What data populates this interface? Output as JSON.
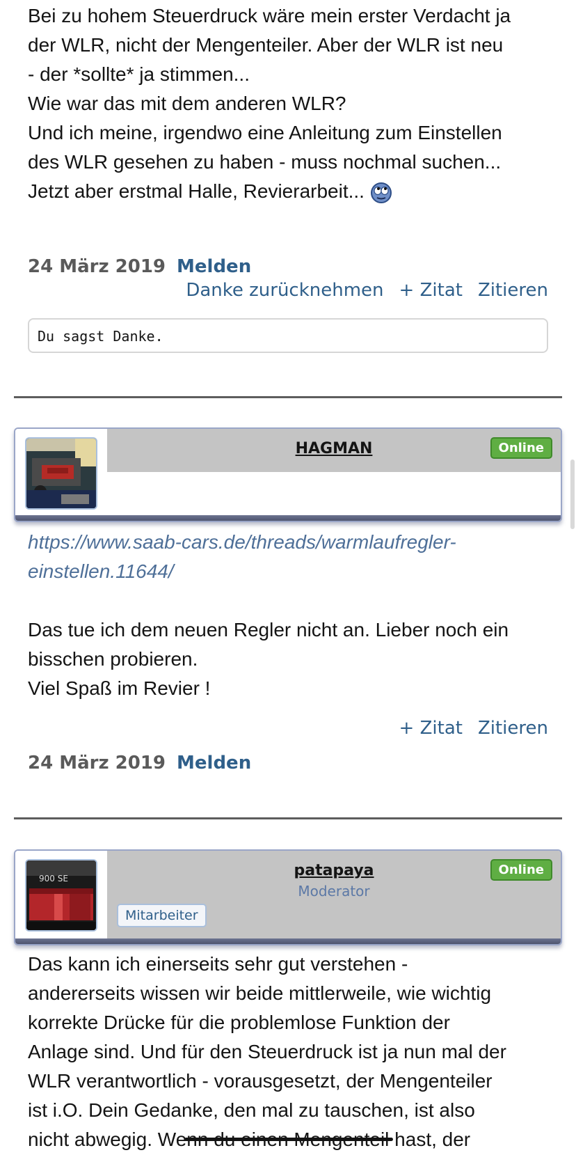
{
  "post1": {
    "lines": [
      "Bei zu hohem Steuerdruck wäre mein erster Verdacht ja",
      "der WLR, nicht der Mengenteiler. Aber der WLR ist neu",
      "- der *sollte* ja stimmen...",
      "Wie war das mit dem anderen WLR?",
      "Und ich meine, irgendwo eine Anleitung zum Einstellen",
      "des WLR gesehen zu haben - muss nochmal suchen...",
      "Jetzt aber erstmal Halle, Revierarbeit..."
    ],
    "date": "24 März 2019",
    "report": "Melden",
    "undo_thanks": "Danke zurücknehmen",
    "plus_quote": "+ Zitat",
    "quote": "Zitieren",
    "thanks_note": "Du sagst Danke."
  },
  "card1": {
    "username": "HAGMAN",
    "status": "Online",
    "avatar_icon": "engine-photo"
  },
  "post2": {
    "link_line1": "https://www.saab-cars.de/threads/warmlaufregler-",
    "link_line2": "einstellen.11644/",
    "lines": [
      "Das tue ich dem neuen Regler nicht an. Lieber noch ein",
      "bisschen probieren.",
      "Viel Spaß im Revier !"
    ],
    "plus_quote": "+ Zitat",
    "quote": "Zitieren",
    "date": "24 März 2019",
    "report": "Melden"
  },
  "card2": {
    "username": "patapaya",
    "role": "Moderator",
    "staff": "Mitarbeiter",
    "status": "Online",
    "avatar_icon": "saab-900-se-taillight-photo"
  },
  "post3": {
    "lines": [
      "Das kann ich einerseits sehr gut verstehen -",
      "andererseits wissen wir beide mittlerweile, wie wichtig",
      "korrekte Drücke für die problemlose Funktion der",
      "Anlage sind. Und für den Steuerdruck ist ja nun mal der",
      "WLR verantwortlich - vorausgesetzt, der Mengenteiler",
      "ist i.O. Dein Gedanke, den mal zu tauschen, ist also",
      "nicht abwegig. Wenn du einen Mengenteil hast, der"
    ]
  }
}
